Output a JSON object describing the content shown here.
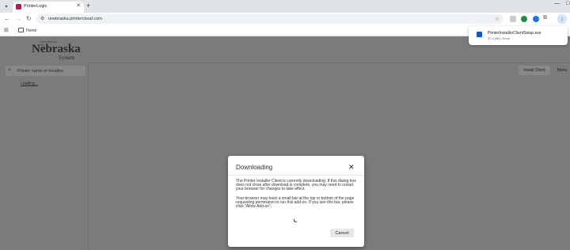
{
  "browser": {
    "tab": {
      "title": "PrinterLogic",
      "close_glyph": "✕"
    },
    "new_tab_glyph": "+",
    "window": {
      "minimize_glyph": "—",
      "maximize_glyph": "□"
    },
    "nav": {
      "back_glyph": "←",
      "forward_glyph": "→",
      "reload_glyph": "↻"
    },
    "url": "unebraska.printercloud.com",
    "star_glyph": "☆",
    "bookmarks": {
      "apps_glyph": "⊞",
      "home_label": "Home"
    },
    "download_glyph": "↓"
  },
  "download_bubble": {
    "filename": "PrinterInstallerClientSetup.exe",
    "status": "37.4 MB • Done"
  },
  "page": {
    "logo": {
      "small": "UNIVERSITY OF",
      "big": "Nebraska",
      "sub": "System"
    },
    "search": {
      "placeholder": "Printer name or location",
      "icon_glyph": "⌕"
    },
    "loading": "Loading...",
    "install_client": "Install Client",
    "menu": "Menu"
  },
  "modal": {
    "title": "Downloading",
    "close_glyph": "✕",
    "paragraph1": "The Printer Installer Client is currently downloading. If this dialog box does not close after download is complete, you may need to restart your browser for changes to take effect.",
    "paragraph2": "Your browser may have a small bar at the top or bottom of the page requesting permission to run this add-on. If you see this bar, please click \"Allow Add-on\".",
    "cancel": "Cancel"
  },
  "colors": {
    "accent": "#0b57d0",
    "tab_favicon": "#b31b57",
    "overlay_gray": "#7b7b7b"
  }
}
